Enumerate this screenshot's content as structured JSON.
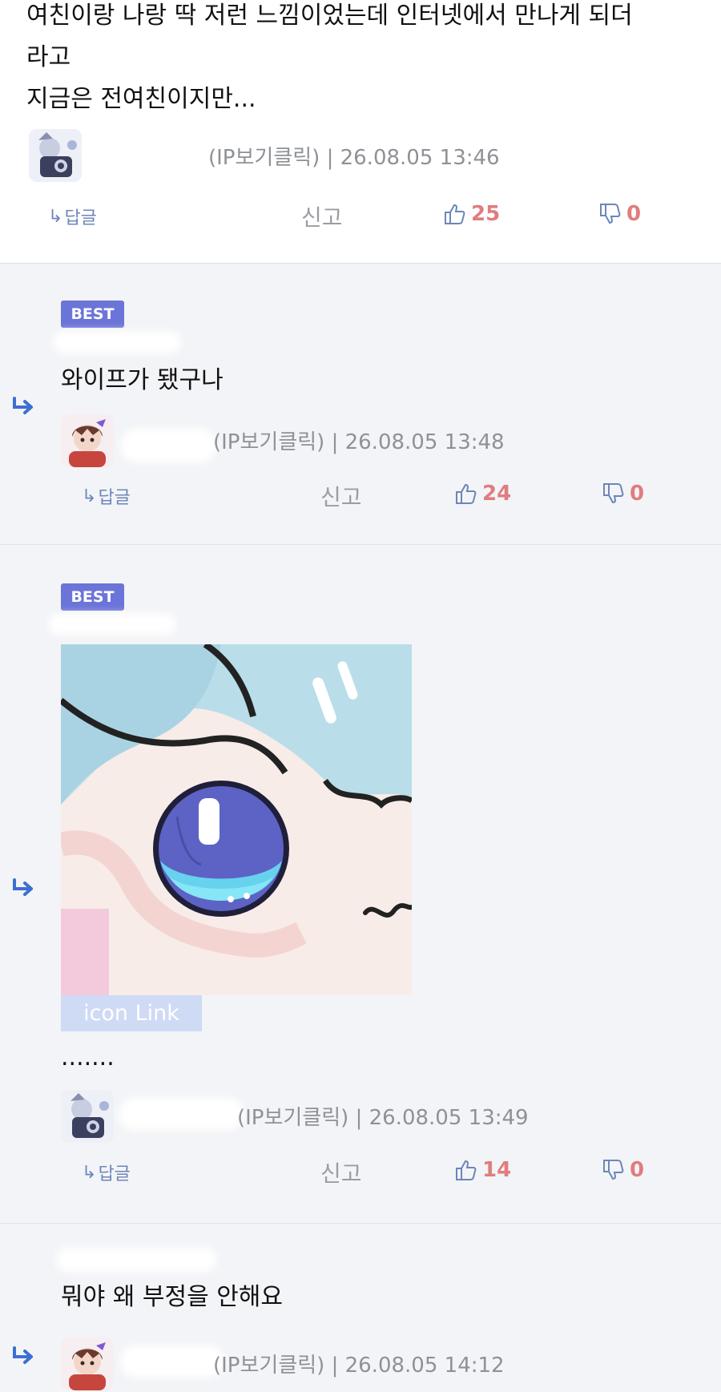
{
  "comments": [
    {
      "text": "여친이랑 나랑 딱 저런 느낌이었는데 인터넷에서 만나게 되더\n라고\n지금은 전여친이지만...",
      "meta": "(IP보기클릭) | 26.08.05 13:46",
      "reply_label": "답글",
      "report_label": "신고",
      "likes": "25",
      "dislikes": "0"
    },
    {
      "badge": "BEST",
      "text": "와이프가 됐구나",
      "meta": "(IP보기클릭) | 26.08.05 13:48",
      "reply_label": "답글",
      "report_label": "신고",
      "likes": "24",
      "dislikes": "0"
    },
    {
      "badge": "BEST",
      "image_link_label": "icon Link",
      "text": ".......",
      "meta": "(IP보기클릭) | 26.08.05 13:49",
      "reply_label": "답글",
      "report_label": "신고",
      "likes": "14",
      "dislikes": "0"
    },
    {
      "text": "뭐야 왜 부정을 안해요",
      "meta": "(IP보기클릭) | 26.08.05 14:12"
    }
  ],
  "icons": {
    "reply_arrow": "reply-arrow-icon",
    "thumbs_up": "thumbs-up-icon",
    "thumbs_down": "thumbs-down-icon"
  },
  "colors": {
    "best_badge": "#6b74d8",
    "vote_count": "#e07d7d",
    "reply_arrow": "#3b6fd4",
    "reply_bg": "#f3f4f7"
  }
}
